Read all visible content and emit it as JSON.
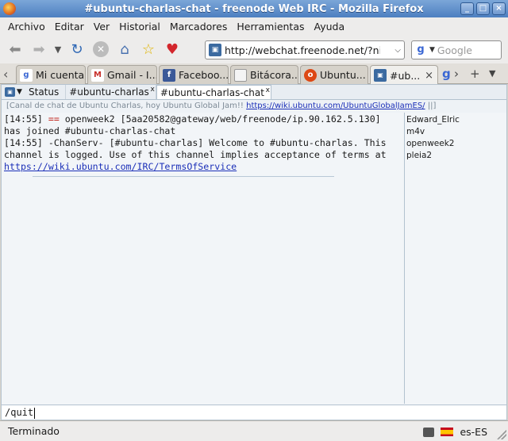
{
  "window": {
    "title": "#ubuntu-charlas-chat - freenode Web IRC - Mozilla Firefox",
    "minimize": "_",
    "maximize": "□",
    "close": "×"
  },
  "menu": [
    "Archivo",
    "Editar",
    "Ver",
    "Historial",
    "Marcadores",
    "Herramientas",
    "Ayuda"
  ],
  "navbar": {
    "url": "http://webchat.freenode.net/?nic",
    "search_placeholder": "Google"
  },
  "tabs": [
    {
      "label": "Mi cuenta",
      "icon": "g-icon",
      "color": "#3a67d4"
    },
    {
      "label": "Gmail - I...",
      "icon": "gmail-icon",
      "color": "#c8302a"
    },
    {
      "label": "Faceboo...",
      "icon": "facebook-icon",
      "color": "#3b5998"
    },
    {
      "label": "Bitácora...",
      "icon": "page-icon",
      "color": "#8a8a8a"
    },
    {
      "label": "Ubuntu...",
      "icon": "ubuntu-icon",
      "color": "#dd4814"
    },
    {
      "label": "#ub...",
      "icon": "irc-icon",
      "color": "#3b6aa0",
      "active": true,
      "close": "×"
    }
  ],
  "irc": {
    "tabs": [
      {
        "label": "Status"
      },
      {
        "label": "#ubuntu-charlas",
        "close": "x"
      },
      {
        "label": "#ubuntu-charlas-chat",
        "close": "x",
        "active": true
      }
    ],
    "topic_text": "[Canal de chat de Ubuntu Charlas, hoy Ubuntu Global Jam!! ",
    "topic_link": "https://wiki.ubuntu.com/UbuntuGlobalJamES/",
    "topic_end": " ||]",
    "messages": {
      "line1_time": "[14:55] ",
      "line1_marker": "==",
      "line1_text": " openweek2 [5aa20582@gateway/web/freenode/ip.90.162.5.130]",
      "line2_text": "has joined #ubuntu-charlas-chat",
      "line3_text": "[14:55] -ChanServ- [#ubuntu-charlas] Welcome to #ubuntu-charlas. This",
      "line4_text": "channel is logged. Use of this channel implies acceptance of terms at",
      "line5_link": "https://wiki.ubuntu.com/IRC/TermsOfService"
    },
    "nicks": [
      "Edward_Elric",
      "m4v",
      "openweek2",
      "pleia2"
    ],
    "input_value": "/quit"
  },
  "status": {
    "text": "Terminado",
    "locale": "es-ES"
  }
}
